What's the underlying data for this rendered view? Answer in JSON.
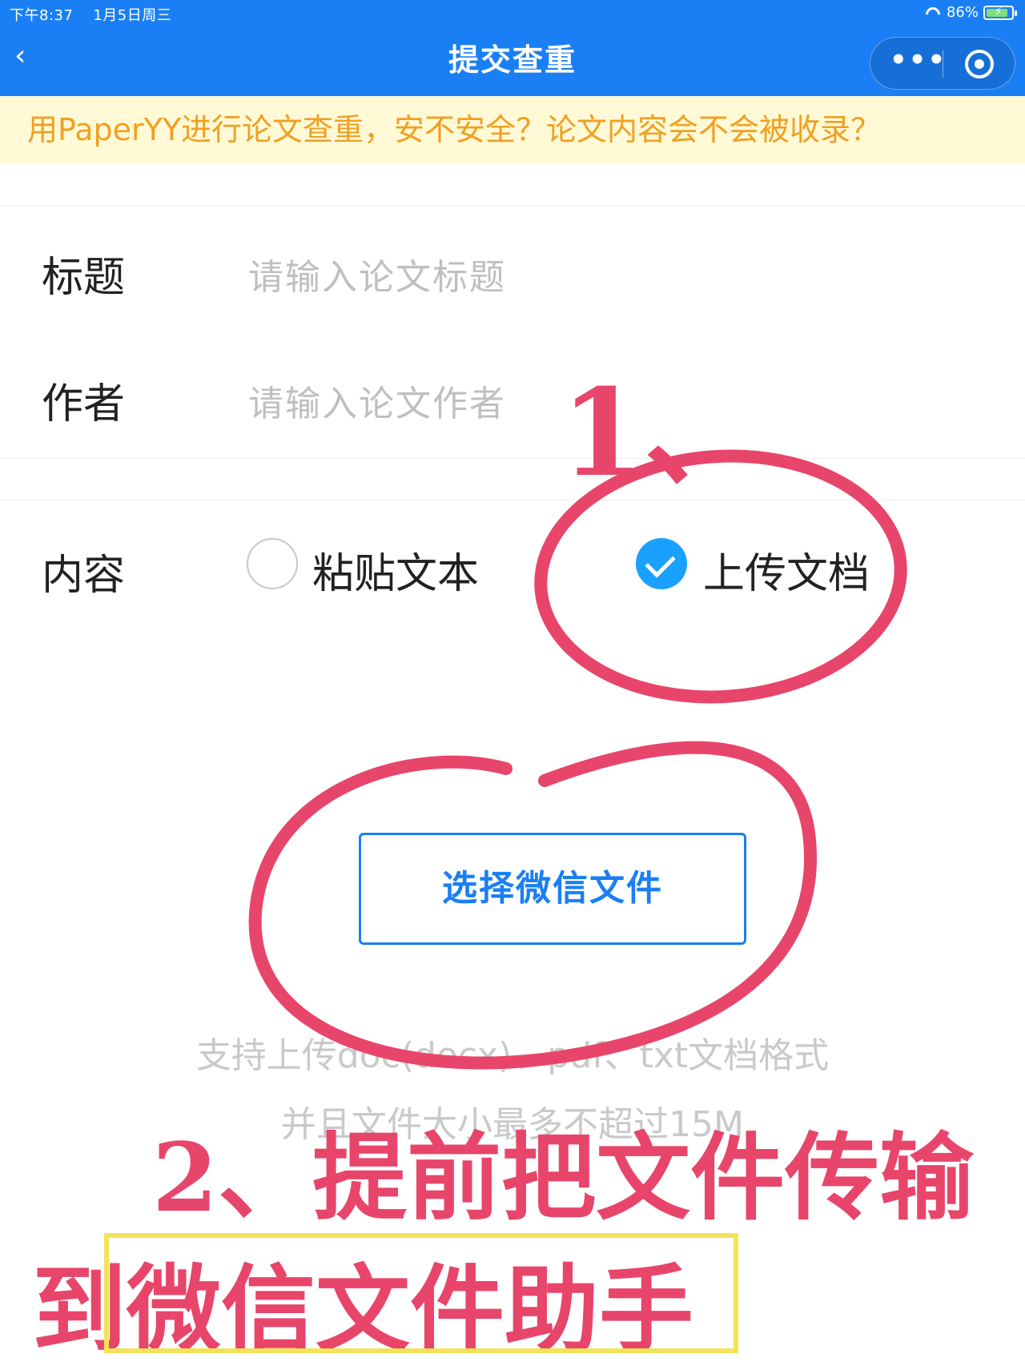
{
  "status_bar": {
    "time": "下午8:37",
    "date": "1月5日周三",
    "battery": "86%"
  },
  "nav": {
    "back_icon": "chevron-left-icon",
    "title": "提交查重",
    "more_icon": "more-dots-icon",
    "close_icon": "target-icon"
  },
  "notice": {
    "text": "用PaperYY进行论文查重，安不安全？论文内容会不会被收录？"
  },
  "form": {
    "title_label": "标题",
    "title_placeholder": "请输入论文标题",
    "author_label": "作者",
    "author_placeholder": "请输入论文作者",
    "content_label": "内容",
    "option_paste": "粘贴文本",
    "option_upload": "上传文档",
    "selected": "上传文档"
  },
  "upload": {
    "button_label": "选择微信文件",
    "hint_line1": "支持上传doc(docx)、pdf、txt文档格式",
    "hint_line2": "并且文件大小最多不超过15M"
  },
  "annotations": {
    "step1": "1、",
    "step2_line1": "2、提前把文件传输",
    "step2_line2": "到微信文件助手",
    "ink_color": "#e8456a",
    "highlight_color": "#f3e35a"
  },
  "colors": {
    "brand": "#1a7ff4",
    "notice_bg": "#fff9d6",
    "notice_text": "#f0a020"
  }
}
